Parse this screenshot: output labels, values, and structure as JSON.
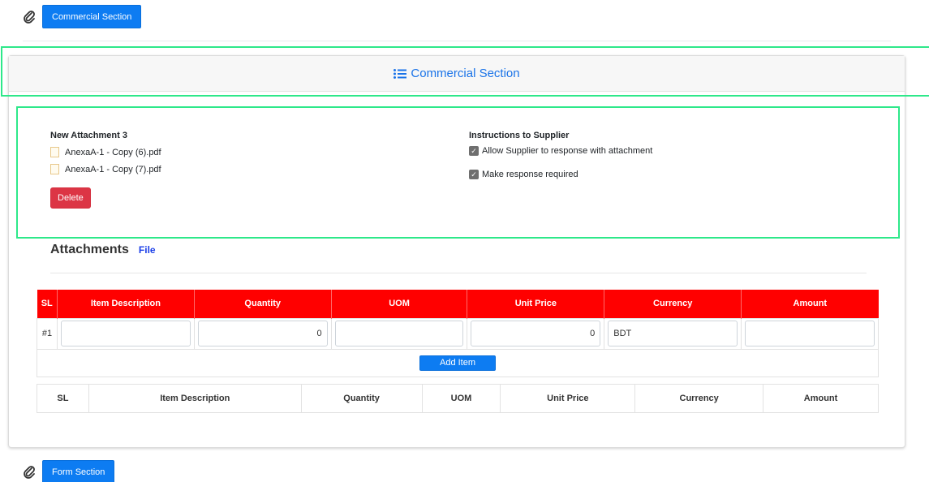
{
  "top_button": "Commercial Section",
  "card": {
    "header_title": "Commercial Section"
  },
  "attachment": {
    "title": "New Attachment 3",
    "files": [
      "AnexaA-1 - Copy (6).pdf",
      "AnexaA-1 - Copy (7).pdf"
    ],
    "delete_label": "Delete"
  },
  "instructions": {
    "title": "Instructions to Supplier",
    "options": [
      {
        "label": "Allow Supplier to response with attachment",
        "checked": true
      },
      {
        "label": "Make response required",
        "checked": true
      }
    ]
  },
  "attachments_section": {
    "heading": "Attachments",
    "link": "File"
  },
  "items_table": {
    "headers": [
      "SL",
      "Item Description",
      "Quantity",
      "UOM",
      "Unit Price",
      "Currency",
      "Amount"
    ],
    "row": {
      "sl": "#1",
      "item_description": "",
      "quantity": "0",
      "uom": "",
      "unit_price": "0",
      "currency": "BDT",
      "amount": ""
    },
    "add_label": "Add Item"
  },
  "summary_table": {
    "headers": [
      "SL",
      "Item Description",
      "Quantity",
      "UOM",
      "Unit Price",
      "Currency",
      "Amount"
    ]
  },
  "bottom_button": "Form Section",
  "colors": {
    "primary": "#0d7cf2",
    "danger": "#dc3545",
    "table_header": "#ff0000",
    "highlight": "#2ee88a"
  }
}
